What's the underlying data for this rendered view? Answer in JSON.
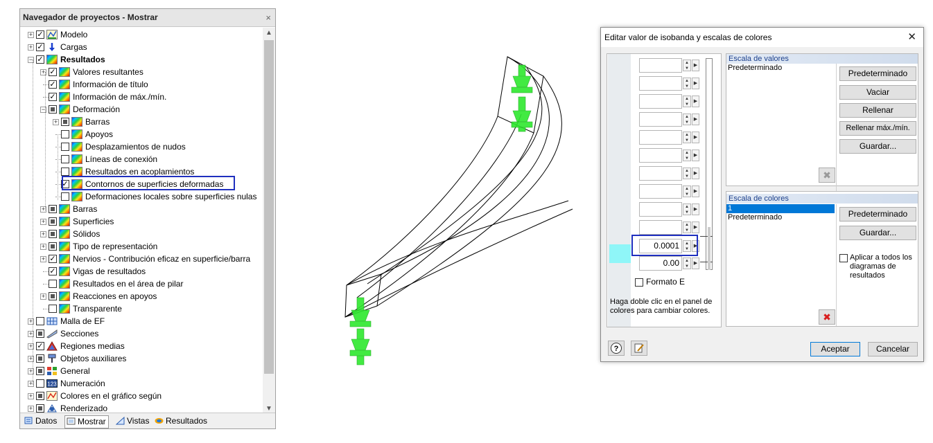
{
  "navigator": {
    "title": "Navegador de proyectos - Mostrar",
    "close": "×",
    "items": [
      {
        "label": "Modelo"
      },
      {
        "label": "Cargas"
      },
      {
        "label": "Resultados"
      },
      {
        "label": "Valores resultantes"
      },
      {
        "label": "Información de título"
      },
      {
        "label": "Información de máx./mín."
      },
      {
        "label": "Deformación"
      },
      {
        "label": "Barras"
      },
      {
        "label": "Apoyos"
      },
      {
        "label": "Desplazamientos de nudos"
      },
      {
        "label": "Líneas de conexión"
      },
      {
        "label": "Resultados en acoplamientos"
      },
      {
        "label": "Contornos de superficies deformadas"
      },
      {
        "label": "Deformaciones locales sobre superficies nulas"
      },
      {
        "label": "Barras"
      },
      {
        "label": "Superficies"
      },
      {
        "label": "Sólidos"
      },
      {
        "label": "Tipo de representación"
      },
      {
        "label": "Nervios - Contribución eficaz en superficie/barra"
      },
      {
        "label": "Vigas de resultados"
      },
      {
        "label": "Resultados en el área de pilar"
      },
      {
        "label": "Reacciones en apoyos"
      },
      {
        "label": "Transparente"
      },
      {
        "label": "Malla de EF"
      },
      {
        "label": "Secciones"
      },
      {
        "label": "Regiones medias"
      },
      {
        "label": "Objetos auxiliares"
      },
      {
        "label": "General"
      },
      {
        "label": "Numeración"
      },
      {
        "label": "Colores en el gráfico según"
      },
      {
        "label": "Renderizado"
      }
    ],
    "tabs": [
      "Datos",
      "Mostrar",
      "Vistas",
      "Resultados"
    ]
  },
  "dialog": {
    "title": "Editar valor de isobanda y escalas de colores",
    "close": "✕",
    "spin_values": [
      "",
      "",
      "",
      "",
      "",
      "",
      "",
      "",
      "",
      "",
      "0.0001",
      "0.00"
    ],
    "format_label": "Formato E",
    "hint": "Haga doble clic en el panel de colores para cambiar colores.",
    "value_scale": {
      "header": "Escala de valores",
      "items": [
        "Predeterminado"
      ],
      "buttons": [
        "Predeterminado",
        "Vaciar",
        "Rellenar",
        "Rellenar máx./mín.",
        "Guardar..."
      ]
    },
    "color_scale": {
      "header": "Escala de colores",
      "items": [
        "1",
        "Predeterminado"
      ],
      "buttons": [
        "Predeterminado",
        "Guardar..."
      ],
      "apply_all": "Aplicar a todos los diagramas de resultados"
    },
    "ok": "Aceptar",
    "cancel": "Cancelar"
  },
  "colors": {
    "highlight_box": "#1f2fbf",
    "selection": "#0078d7",
    "support_green": "#2ee82e",
    "swatch_cyan": "#8ff6f8"
  }
}
